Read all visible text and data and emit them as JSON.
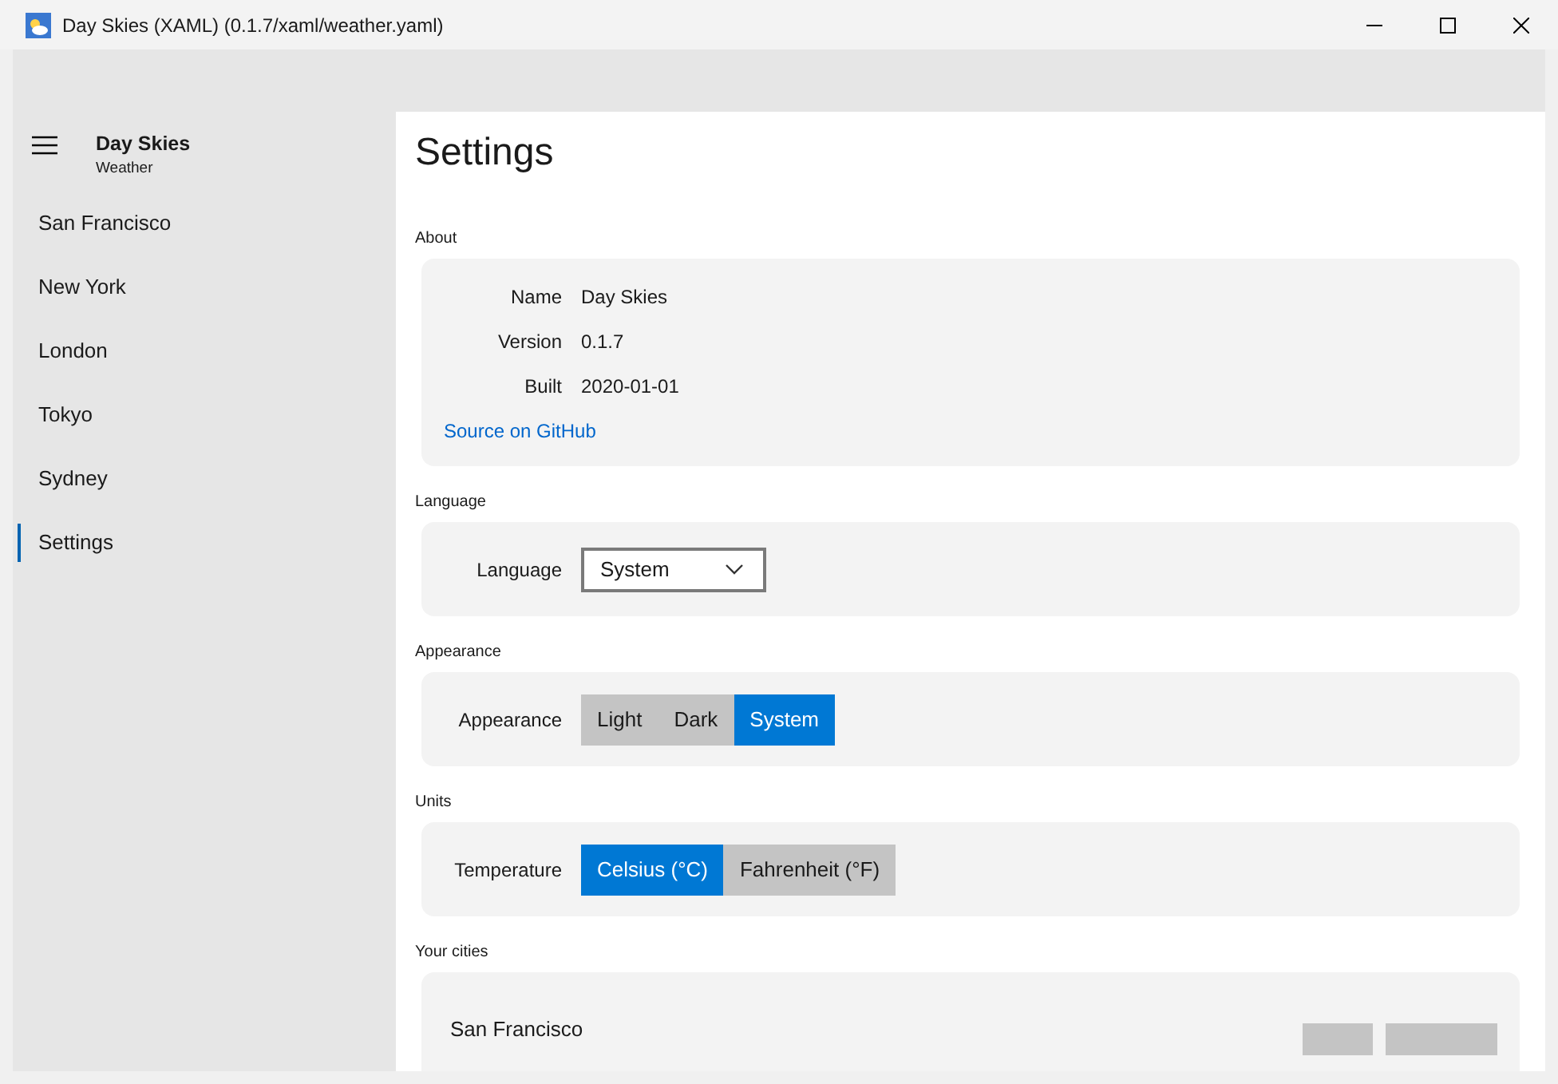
{
  "window": {
    "title": "Day Skies (XAML) (0.1.7/xaml/weather.yaml)"
  },
  "nav": {
    "app_title": "Day Skies",
    "app_subtitle": "Weather",
    "items": [
      {
        "label": "San Francisco",
        "selected": false
      },
      {
        "label": "New York",
        "selected": false
      },
      {
        "label": "London",
        "selected": false
      },
      {
        "label": "Tokyo",
        "selected": false
      },
      {
        "label": "Sydney",
        "selected": false
      },
      {
        "label": "Settings",
        "selected": true
      }
    ]
  },
  "page": {
    "title": "Settings",
    "sections": [
      {
        "heading": "About",
        "kind": "about",
        "rows": [
          {
            "label": "Name",
            "value": "Day Skies"
          },
          {
            "label": "Version",
            "value": "0.1.7"
          },
          {
            "label": "Built",
            "value": "2020-01-01"
          }
        ],
        "link": "Source on GitHub"
      },
      {
        "heading": "Language",
        "kind": "dropdown",
        "label": "Language",
        "value": "System"
      },
      {
        "heading": "Appearance",
        "kind": "segmented",
        "label": "Appearance",
        "options": [
          {
            "label": "Light",
            "selected": false
          },
          {
            "label": "Dark",
            "selected": false
          },
          {
            "label": "System",
            "selected": true
          }
        ]
      },
      {
        "heading": "Units",
        "kind": "segmented",
        "label": "Temperature",
        "options": [
          {
            "label": "Celsius (°C)",
            "selected": true
          },
          {
            "label": "Fahrenheit (°F)",
            "selected": false
          }
        ]
      },
      {
        "heading": "Your cities",
        "kind": "cities",
        "cities": [
          {
            "name": "San Francisco"
          }
        ]
      }
    ]
  }
}
